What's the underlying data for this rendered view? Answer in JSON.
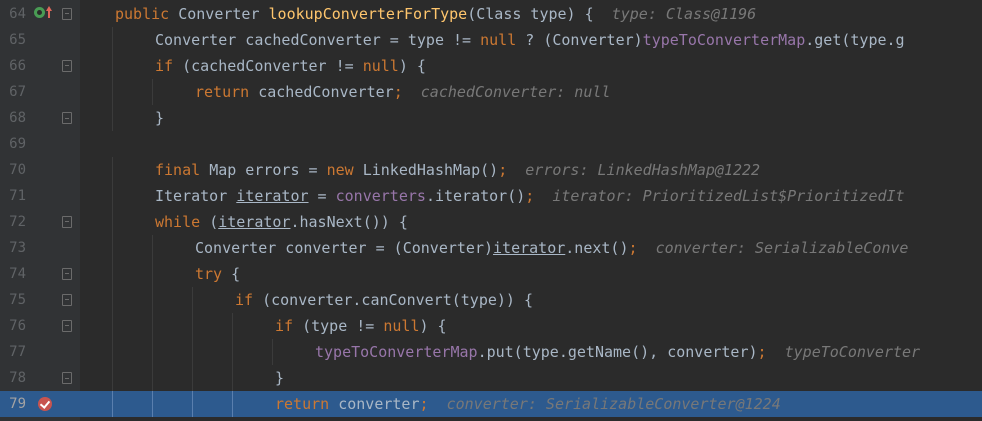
{
  "lines": [
    {
      "n": "64",
      "segs": [
        [
          "kw",
          "public "
        ],
        [
          "",
          "Converter "
        ],
        [
          "fn",
          "lookupConverterForType"
        ],
        [
          "",
          "(Class type) {  "
        ],
        [
          "hint",
          "type: Class@1196"
        ]
      ]
    },
    {
      "n": "65",
      "segs": [
        [
          "",
          "Converter cachedConverter = type != "
        ],
        [
          "kw",
          "null"
        ],
        [
          "",
          " ? (Converter)"
        ],
        [
          "fld",
          "typeToConverterMap"
        ],
        [
          "",
          ".get(type.g"
        ]
      ]
    },
    {
      "n": "66",
      "segs": [
        [
          "kw",
          "if "
        ],
        [
          "",
          "(cachedConverter != "
        ],
        [
          "kw",
          "null"
        ],
        [
          "",
          ") {"
        ]
      ]
    },
    {
      "n": "67",
      "segs": [
        [
          "kw",
          "return "
        ],
        [
          "",
          "cachedConverter"
        ],
        [
          "kw",
          ";"
        ],
        [
          "",
          "  "
        ],
        [
          "hint",
          "cachedConverter: null"
        ]
      ]
    },
    {
      "n": "68",
      "segs": [
        [
          "",
          "}"
        ]
      ]
    },
    {
      "n": "69",
      "segs": []
    },
    {
      "n": "70",
      "segs": [
        [
          "kw",
          "final "
        ],
        [
          "",
          "Map errors = "
        ],
        [
          "kw",
          "new "
        ],
        [
          "",
          "LinkedHashMap()"
        ],
        [
          "kw",
          ";"
        ],
        [
          "",
          "  "
        ],
        [
          "hint",
          "errors: LinkedHashMap@1222"
        ]
      ]
    },
    {
      "n": "71",
      "segs": [
        [
          "",
          "Iterator "
        ],
        [
          "ul",
          "iterator"
        ],
        [
          "",
          " = "
        ],
        [
          "fld",
          "converters"
        ],
        [
          "",
          ".iterator()"
        ],
        [
          "kw",
          ";"
        ],
        [
          "",
          "  "
        ],
        [
          "hint",
          "iterator: PrioritizedList$PrioritizedIt"
        ]
      ]
    },
    {
      "n": "72",
      "segs": [
        [
          "kw",
          "while "
        ],
        [
          "",
          "("
        ],
        [
          "ul",
          "iterator"
        ],
        [
          "",
          ".hasNext()) {"
        ]
      ]
    },
    {
      "n": "73",
      "segs": [
        [
          "",
          "Converter converter = (Converter)"
        ],
        [
          "ul",
          "iterator"
        ],
        [
          "",
          ".next()"
        ],
        [
          "kw",
          ";"
        ],
        [
          "",
          "  "
        ],
        [
          "hint",
          "converter: SerializableConve"
        ]
      ]
    },
    {
      "n": "74",
      "segs": [
        [
          "kw",
          "try "
        ],
        [
          "",
          "{"
        ]
      ]
    },
    {
      "n": "75",
      "segs": [
        [
          "kw",
          "if "
        ],
        [
          "",
          "(converter.canConvert(type)) {"
        ]
      ]
    },
    {
      "n": "76",
      "segs": [
        [
          "kw",
          "if "
        ],
        [
          "",
          "(type != "
        ],
        [
          "kw",
          "null"
        ],
        [
          "",
          ") {"
        ]
      ]
    },
    {
      "n": "77",
      "segs": [
        [
          "fld",
          "typeToConverterMap"
        ],
        [
          "",
          ".put(type.getName(), converter)"
        ],
        [
          "kw",
          ";"
        ],
        [
          "",
          "  "
        ],
        [
          "hint",
          "typeToConverter"
        ]
      ]
    },
    {
      "n": "78",
      "segs": [
        [
          "",
          "}"
        ]
      ]
    },
    {
      "n": "79",
      "segs": [
        [
          "kw",
          "return "
        ],
        [
          "",
          "converter"
        ],
        [
          "kw",
          ";"
        ],
        [
          "",
          "  "
        ],
        [
          "hint",
          "converter: SerializableConverter@1224"
        ]
      ]
    }
  ],
  "indent_levels": [
    0,
    1,
    1,
    2,
    1,
    0,
    1,
    1,
    1,
    2,
    2,
    3,
    4,
    5,
    4,
    4
  ],
  "current_line_index": 15,
  "colors": {
    "background": "#2b2b2b",
    "gutter": "#313335",
    "current_line": "#2d5a8e",
    "keyword": "#cc7832",
    "method": "#ffc66d",
    "field": "#9876aa",
    "hint": "#787878",
    "text": "#a9b7c6"
  },
  "gutter_icons": {
    "line_64": [
      "override-icon",
      "arrow-up-icon"
    ],
    "line_79": [
      "breakpoint-icon"
    ]
  }
}
